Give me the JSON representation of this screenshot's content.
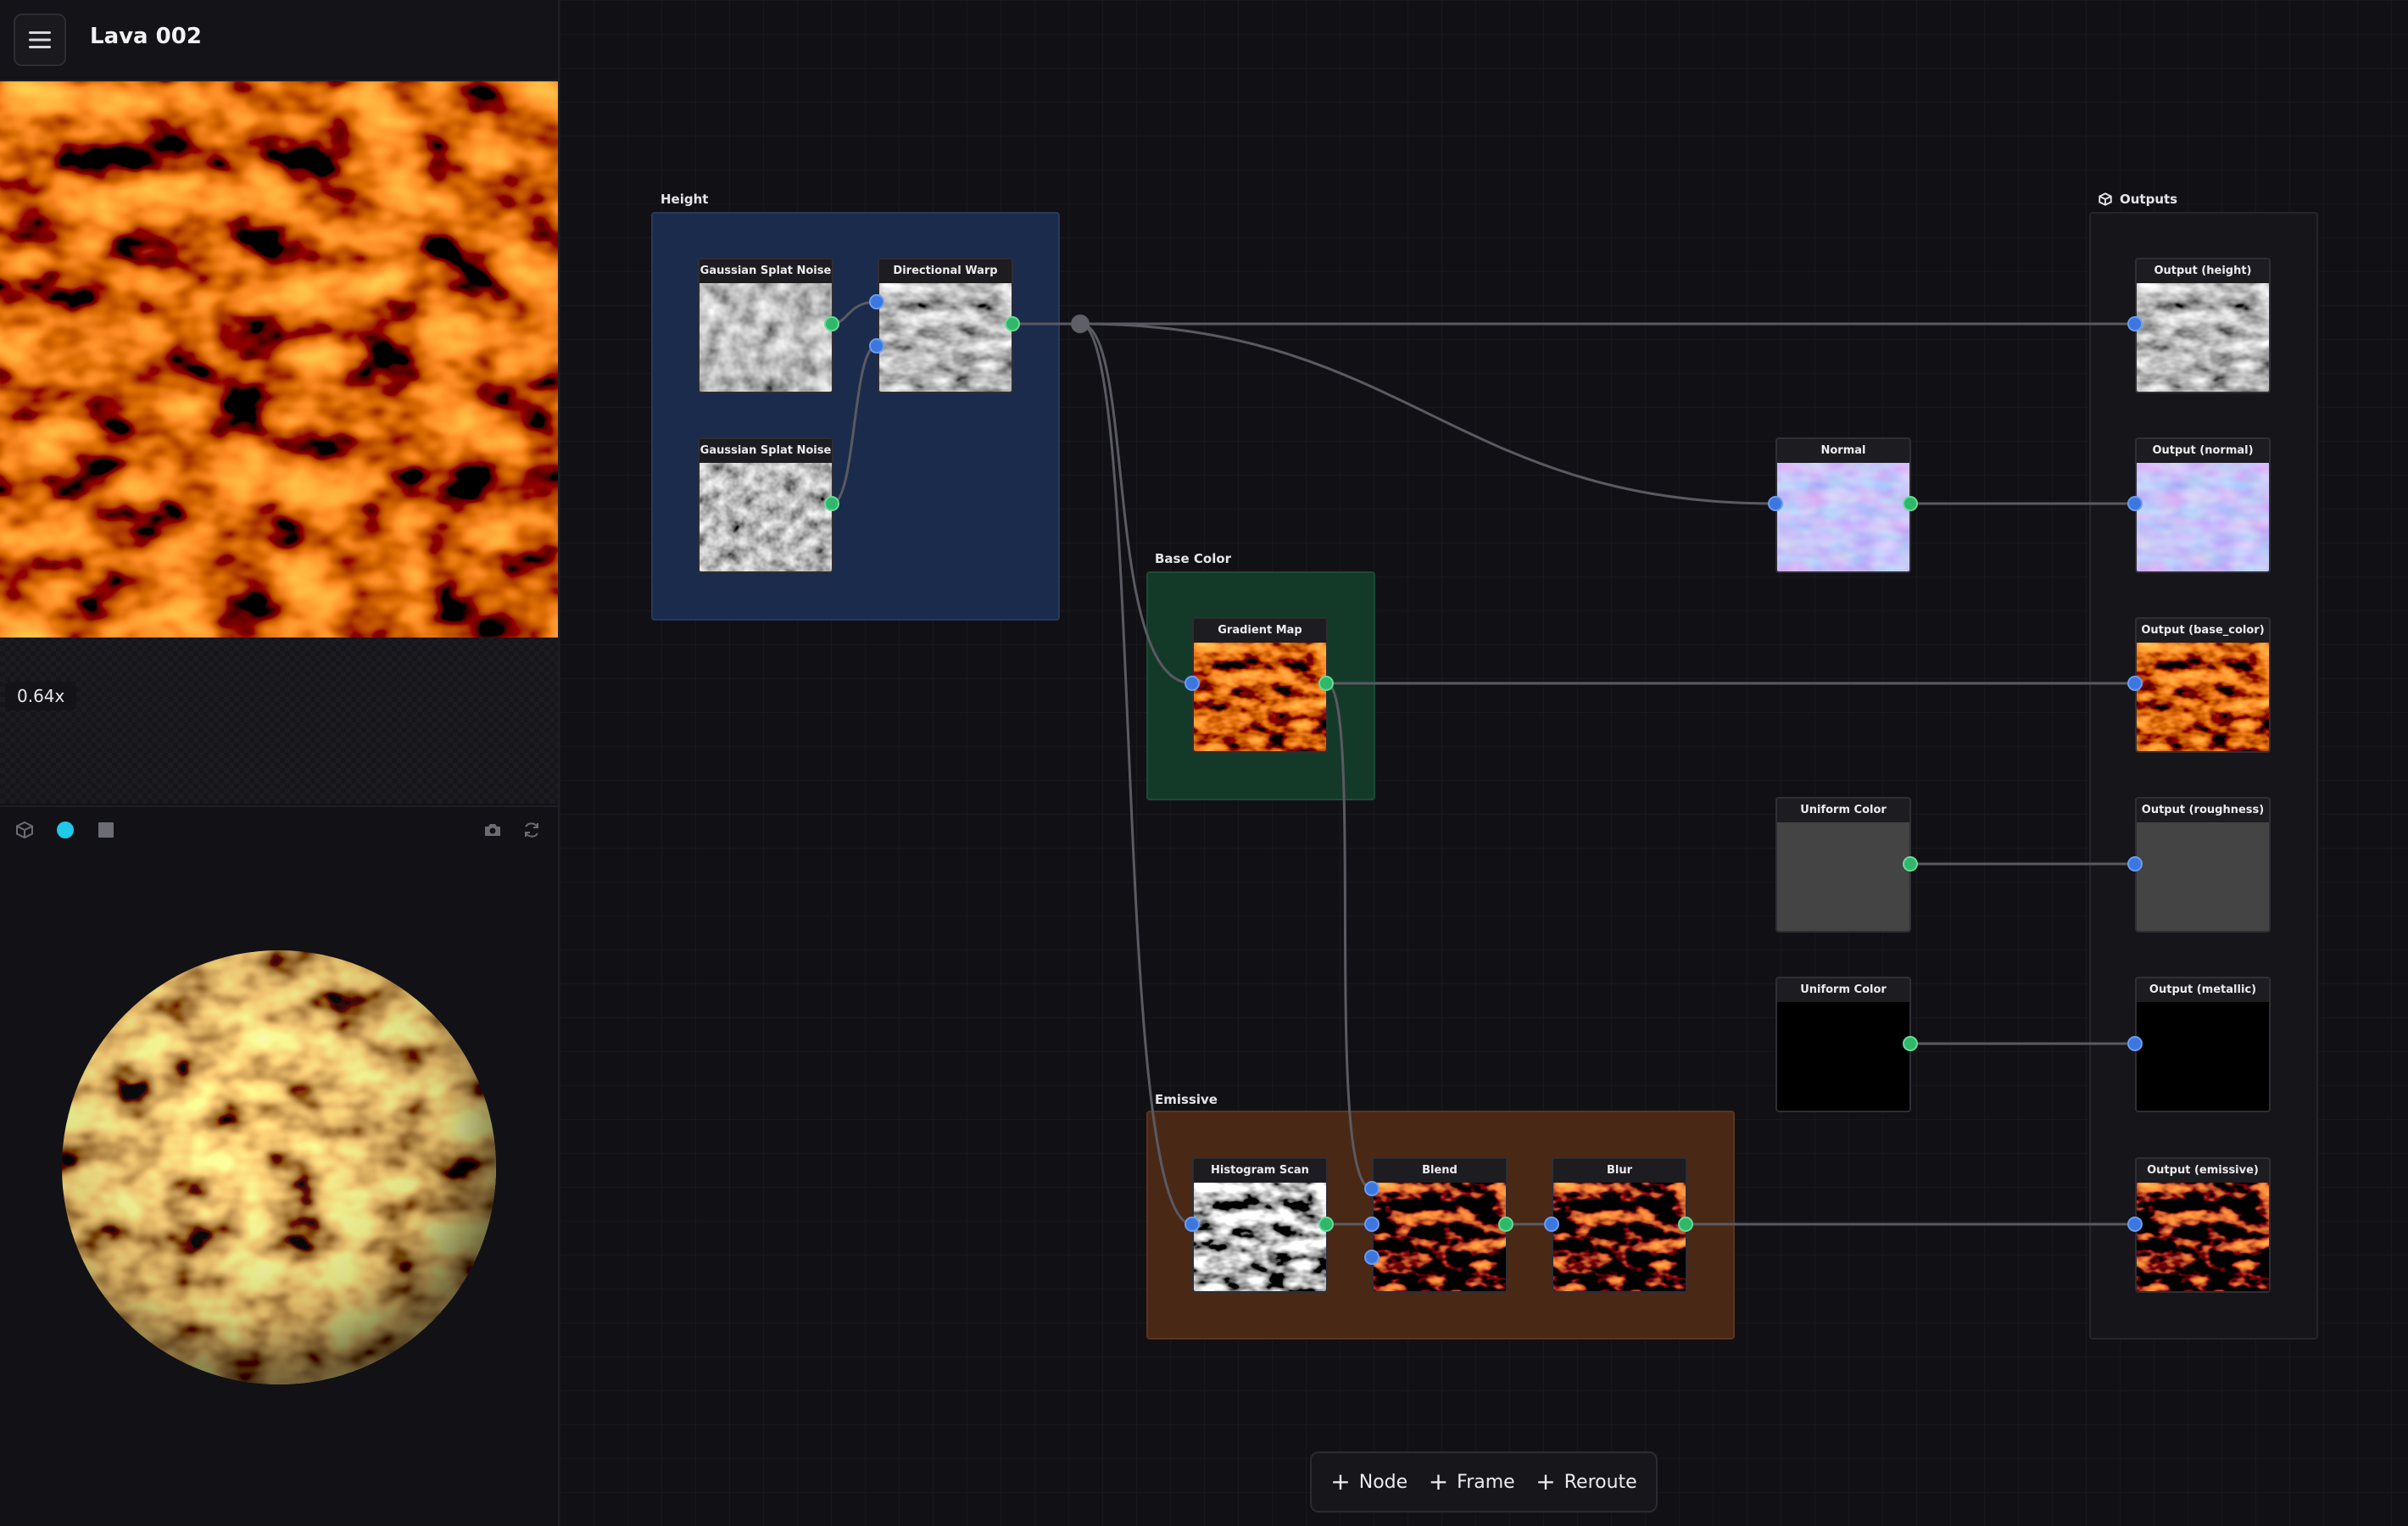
{
  "app": {
    "title": "Lava 002"
  },
  "preview2d": {
    "zoom": "0.64x",
    "icons": [
      "grid-icon",
      "refresh-icon"
    ]
  },
  "preview3d": {
    "icons": [
      "cube-icon",
      "sphere-icon",
      "plane-icon",
      "camera-icon",
      "refresh-icon"
    ]
  },
  "frames": {
    "height": "Height",
    "base_color": "Base Color",
    "emissive": "Emissive",
    "outputs": "Outputs"
  },
  "nodes": {
    "gaussian1": "Gaussian Splat Noise",
    "directional_warp": "Directional Warp",
    "gaussian2": "Gaussian Splat Noise",
    "normal": "Normal",
    "gradient_map": "Gradient Map",
    "uniform1": "Uniform Color",
    "uniform2": "Uniform Color",
    "histogram_scan": "Histogram Scan",
    "blend": "Blend",
    "blur": "Blur",
    "out_height": "Output (height)",
    "out_normal": "Output (normal)",
    "out_base": "Output (base_color)",
    "out_rough": "Output (roughness)",
    "out_metal": "Output (metallic)",
    "out_emissive": "Output (emissive)"
  },
  "colors": {
    "height_frame": "#1b2b4b",
    "base_frame": "#133a28",
    "emissive_frame": "#4a2816",
    "outputs_frame": "#15151a",
    "roughness": "#444444",
    "metallic": "#000000"
  },
  "toolbar": {
    "node": "Node",
    "frame": "Frame",
    "reroute": "Reroute"
  }
}
